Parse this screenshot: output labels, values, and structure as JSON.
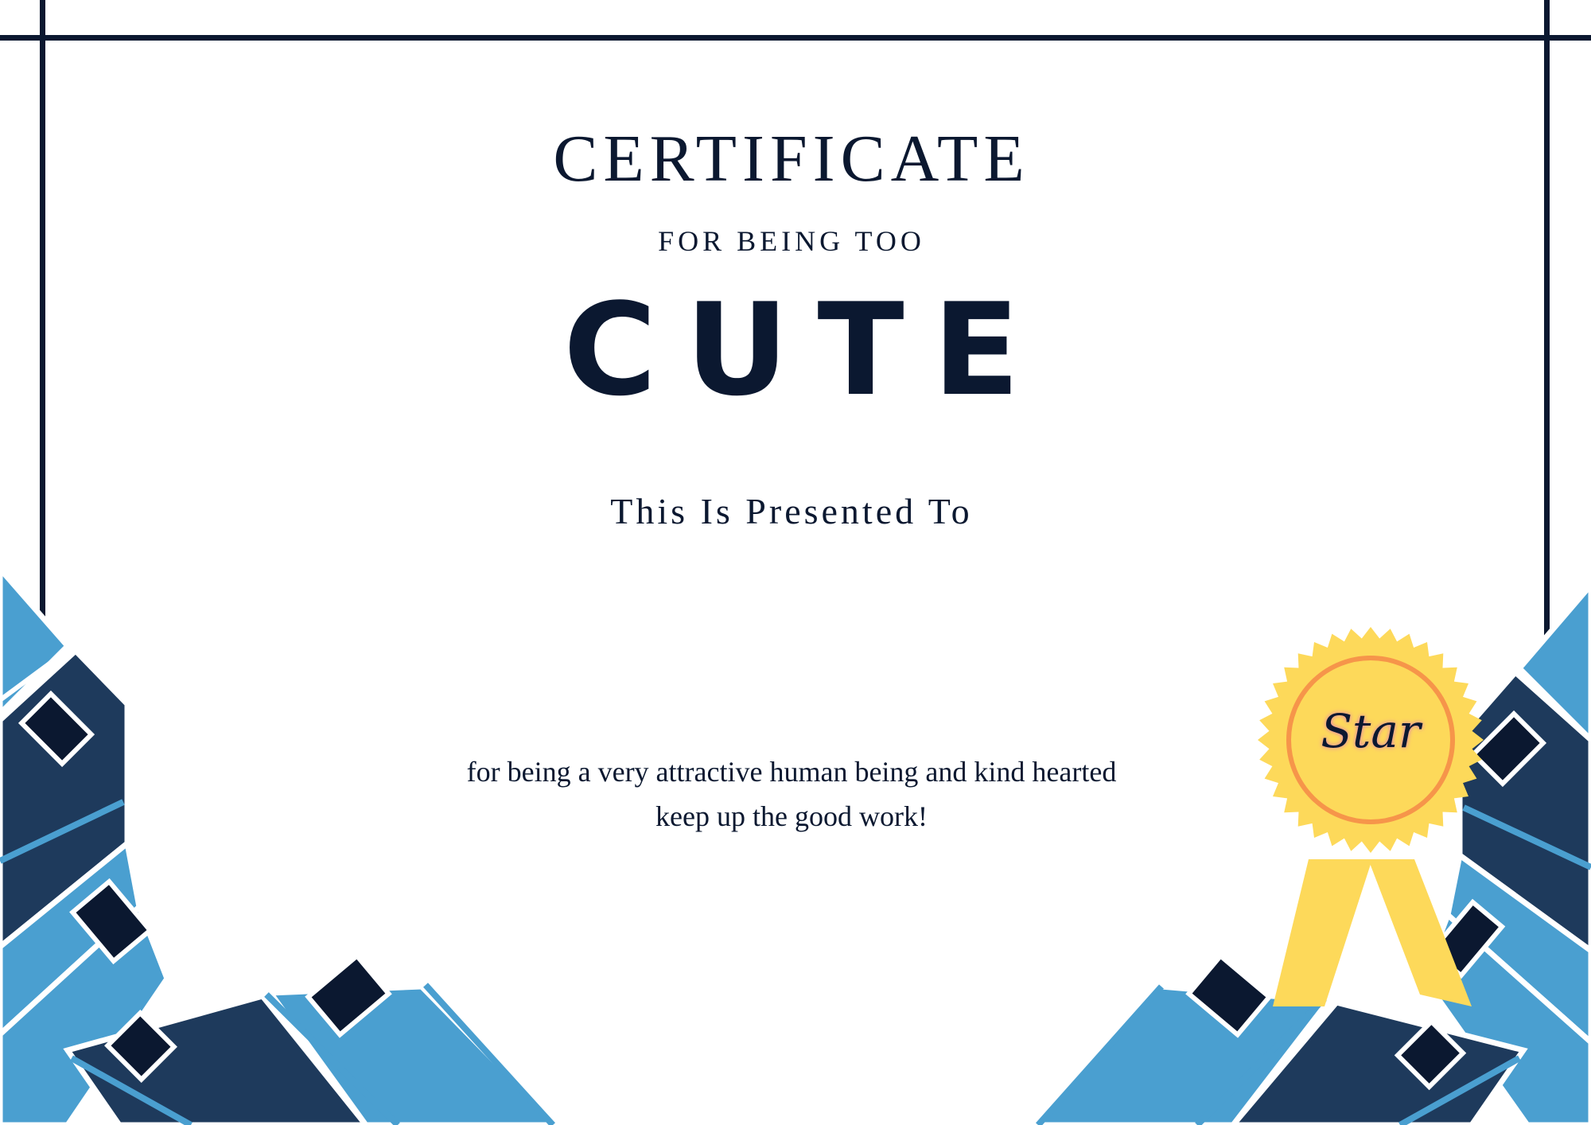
{
  "certificate": {
    "title": "CERTIFICATE",
    "subtitle": "FOR BEING TOO",
    "quality": "CUTE",
    "presented_to": "This Is Presented To",
    "body_line1": "for being a very attractive human being and kind hearted",
    "body_line2": "keep up the good work!"
  },
  "badge": {
    "label": "Star",
    "icon": "award-ribbon-icon"
  },
  "colors": {
    "navy": "#0b1830",
    "dark_blue": "#1e3a5c",
    "light_blue": "#4a9fd0",
    "gold": "#fdd95a",
    "orange": "#f6954a"
  }
}
